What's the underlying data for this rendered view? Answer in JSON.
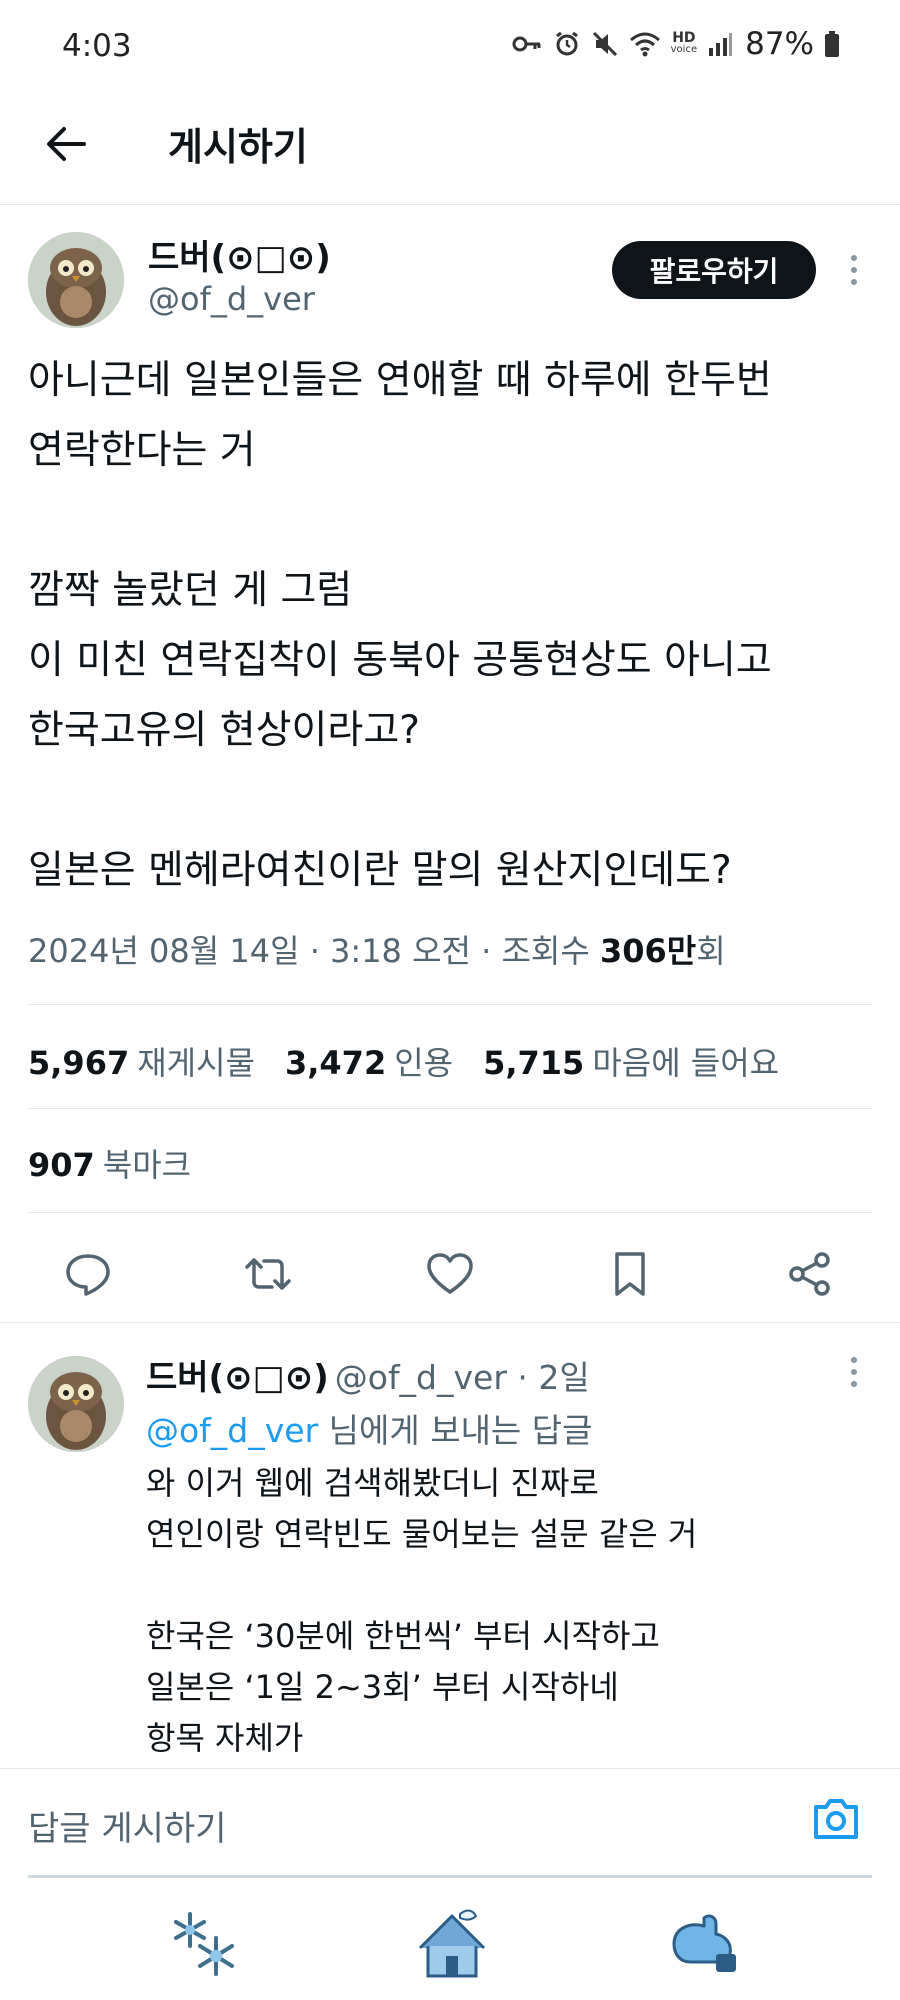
{
  "status_bar": {
    "time": "4:03",
    "battery": "87%",
    "hd_label": "HD",
    "voice_label": "voice"
  },
  "header": {
    "title": "게시하기"
  },
  "tweet": {
    "display_name": "드버(⊙□⊙)",
    "handle": "@of_d_ver",
    "follow_label": "팔로우하기",
    "text": "아니근데 일본인들은 연애할 때 하루에 한두번\n연락한다는 거\n\n깜짝 놀랐던 게 그럼\n이 미친 연락집착이 동북아 공통현상도 아니고\n한국고유의 현상이라고?\n\n일본은 멘헤라여친이란 말의 원산지인데도?",
    "meta_prefix": "2024년 08월 14일 · 3:18 오전 · 조회수 ",
    "views": "306만",
    "views_suffix": "회",
    "stats": {
      "retweets": "5,967",
      "retweets_label": "재게시물",
      "quotes": "3,472",
      "quotes_label": "인용",
      "likes": "5,715",
      "likes_label": "마음에 들어요",
      "bookmarks": "907",
      "bookmarks_label": "북마크"
    }
  },
  "reply": {
    "display_name": "드버(⊙□⊙)",
    "handle_time": "@of_d_ver · 2일",
    "mention": "@of_d_ver",
    "reply_to_suffix": " 님에게 보내는 답글",
    "text": "와 이거 웹에 검색해봤더니 진짜로\n연인이랑 연락빈도 물어보는 설문 같은 거\n\n한국은 ‘30분에 한번씩’ 부터 시작하고\n일본은 ‘1일 2~3회’ 부터 시작하네\n항목 자체가"
  },
  "compose": {
    "placeholder": "답글 게시하기"
  },
  "colors": {
    "accent": "#1d9bf0",
    "secondary_text": "#536471",
    "primary_text": "#0f1419"
  },
  "icons": {
    "back": "arrow-left-icon",
    "reply": "comment-icon",
    "retweet": "retweet-icon",
    "like": "heart-icon",
    "bookmark": "bookmark-icon",
    "share": "share-icon",
    "camera": "camera-icon",
    "nav_1": "snowflake-icon",
    "nav_2": "snow-house-icon",
    "nav_3": "mitten-icon"
  }
}
